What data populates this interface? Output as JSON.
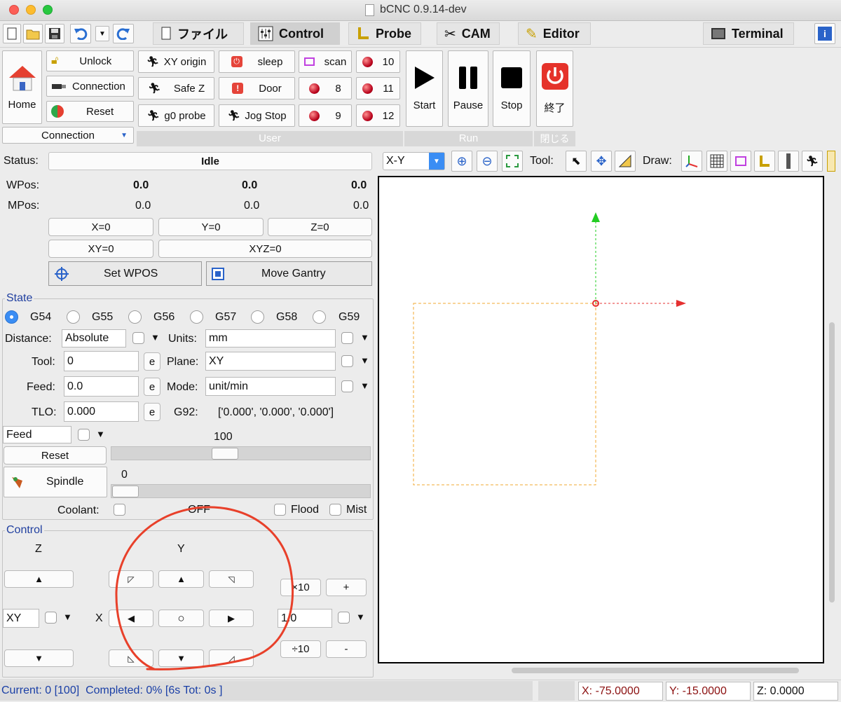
{
  "window": {
    "title": "bCNC 0.9.14-dev"
  },
  "tabs": [
    {
      "label": "ファイル",
      "icon": "document-icon"
    },
    {
      "label": "Control",
      "icon": "control-panel-icon"
    },
    {
      "label": "Probe",
      "icon": "probe-icon"
    },
    {
      "label": "CAM",
      "icon": "wrench-icon"
    },
    {
      "label": "Editor",
      "icon": "pencil-icon"
    },
    {
      "label": "Terminal",
      "icon": "terminal-icon"
    }
  ],
  "connection": {
    "home_label": "Home",
    "unlock_label": "Unlock",
    "connection_label": "Connection",
    "reset_label": "Reset",
    "group_label": "Connection"
  },
  "user": {
    "group_label": "User",
    "buttons": [
      "XY origin",
      "sleep",
      "scan",
      "10",
      "Safe Z",
      "Door",
      "8",
      "11",
      "g0 probe",
      "Jog Stop",
      "9",
      "12"
    ]
  },
  "run": {
    "group_label": "Run",
    "start": "Start",
    "pause": "Pause",
    "stop": "Stop"
  },
  "close": {
    "group_label": "閉じる",
    "exit": "終了"
  },
  "status": {
    "status_label": "Status:",
    "status_value": "Idle",
    "wpos_label": "WPos:",
    "mpos_label": "MPos:",
    "wpos": [
      "0.0",
      "0.0",
      "0.0"
    ],
    "mpos": [
      "0.0",
      "0.0",
      "0.0"
    ],
    "zero_buttons": [
      "X=0",
      "Y=0",
      "Z=0",
      "XY=0",
      "XYZ=0"
    ],
    "set_wpos": "Set WPOS",
    "move_gantry": "Move Gantry"
  },
  "state": {
    "title": "State",
    "wcs": [
      "G54",
      "G55",
      "G56",
      "G57",
      "G58",
      "G59"
    ],
    "selected_wcs": "G54",
    "distance_label": "Distance:",
    "distance_value": "Absolute",
    "units_label": "Units:",
    "units_value": "mm",
    "tool_label": "Tool:",
    "tool_value": "0",
    "plane_label": "Plane:",
    "plane_value": "XY",
    "feed_label": "Feed:",
    "feed_value": "0.0",
    "mode_label": "Mode:",
    "mode_value": "unit/min",
    "tlo_label": "TLO:",
    "tlo_value": "0.000",
    "g92_label": "G92:",
    "g92_value": "['0.000', '0.000', '0.000']",
    "e_label": "e",
    "override_select": "Feed",
    "override_value": "100",
    "override_level": 100,
    "reset_label": "Reset",
    "spindle_label": "Spindle",
    "spindle_value": "0",
    "spindle_level": 0,
    "coolant_label": "Coolant:",
    "coolant_state": "OFF",
    "flood_label": "Flood",
    "mist_label": "Mist"
  },
  "control": {
    "title": "Control",
    "z_label": "Z",
    "y_label": "Y",
    "x_label": "X",
    "plane_select": "XY",
    "step_value": "1.0",
    "times10": "×10",
    "plus": "+",
    "div10": "÷10",
    "minus": "-",
    "up_arrow": "▲",
    "down_arrow": "▼",
    "left_arrow": "◀",
    "right_arrow": "▶",
    "center": "○",
    "up_left": "◸",
    "up_right": "◹",
    "down_left": "◺",
    "down_right": "◿"
  },
  "canvas_toolbar": {
    "view": "X-Y",
    "tool_label": "Tool:",
    "draw_label": "Draw:"
  },
  "statusbar": {
    "progress": "Current: 0 [100]  Completed: 0% [6s Tot: 0s ]",
    "x": "X: -75.0000",
    "y": "Y: -15.0000",
    "z": "Z: 0.0000"
  },
  "colors": {
    "status_text": "#1a3fa6",
    "coord_text": "#8b1010",
    "annotation": "#e8402a",
    "x_axis": "#e53030",
    "y_axis": "#22cc22",
    "margin_box": "#f0a830"
  }
}
